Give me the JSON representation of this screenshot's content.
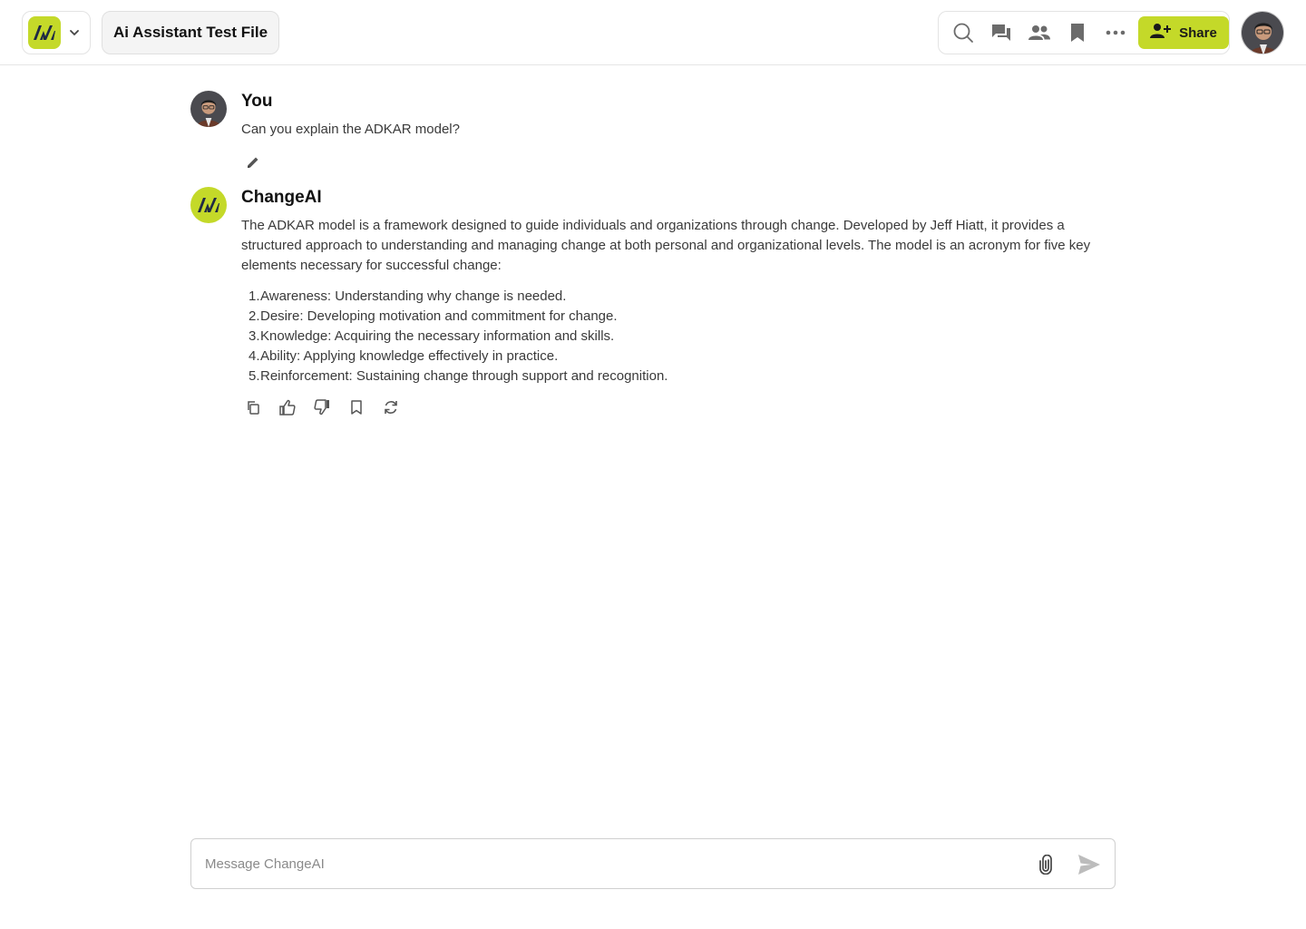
{
  "colors": {
    "accent": "#c4d929",
    "logo_dark": "#1f2a44",
    "icon_gray": "#6b6b6b"
  },
  "header": {
    "workspace_logo": "changeai-logo",
    "dropdown_icon": "chevron-down-icon",
    "file_title": "Ai Assistant Test File",
    "toolbar": {
      "icons": [
        "search-icon",
        "chat-icon",
        "people-icon",
        "bookmark-icon",
        "more-icon"
      ],
      "share_label": "Share",
      "share_icon": "person-add-icon"
    },
    "user_avatar": "user-avatar"
  },
  "conversation": {
    "user_message": {
      "sender": "You",
      "text": "Can you explain the ADKAR model?",
      "edit_icon": "pencil-icon"
    },
    "ai_message": {
      "sender": "ChangeAI",
      "paragraph": "The ADKAR model is a framework designed to guide individuals and organizations through change. Developed by Jeff Hiatt, it provides a structured approach to understanding and managing change at both personal and organizational levels. The model is an acronym for five key elements necessary for successful change:",
      "list": [
        {
          "num": "1.",
          "text": "Awareness: Understanding why change is needed."
        },
        {
          "num": "2.",
          "text": "Desire: Developing motivation and commitment for change."
        },
        {
          "num": "3.",
          "text": "Knowledge: Acquiring the necessary information and skills."
        },
        {
          "num": "4.",
          "text": "Ability: Applying knowledge effectively in practice."
        },
        {
          "num": "5.",
          "text": "Reinforcement: Sustaining change through support and recognition."
        }
      ],
      "action_icons": [
        "copy-icon",
        "thumbs-up-icon",
        "thumbs-down-icon",
        "bookmark-icon",
        "regenerate-icon"
      ]
    }
  },
  "composer": {
    "placeholder": "Message ChangeAI",
    "value": "",
    "attach_icon": "paperclip-icon",
    "send_icon": "send-icon"
  }
}
